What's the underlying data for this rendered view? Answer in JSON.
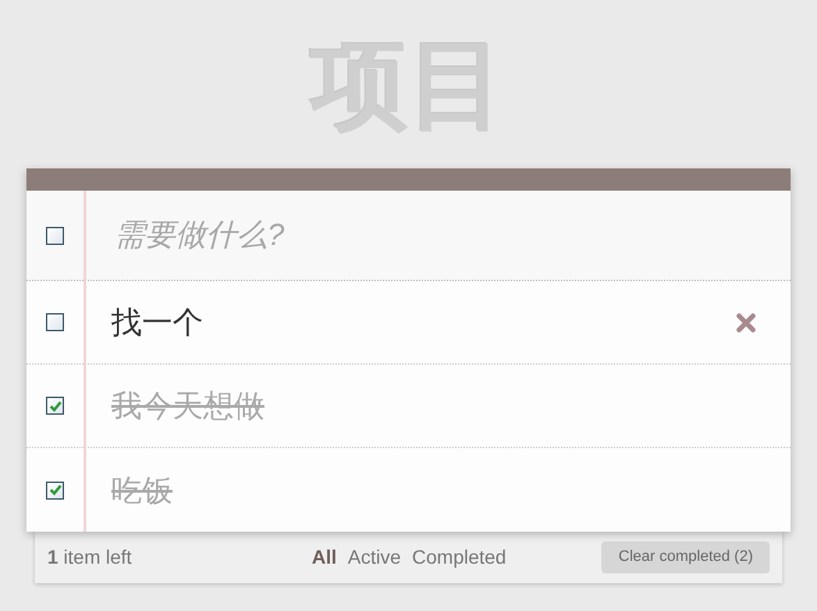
{
  "title": "项目",
  "new_todo": {
    "placeholder": "需要做什么?",
    "toggle_all_checked": false
  },
  "todos": [
    {
      "text": "找一个",
      "completed": false,
      "show_delete": true
    },
    {
      "text": "我今天想做",
      "completed": true,
      "show_delete": false
    },
    {
      "text": "吃饭",
      "completed": true,
      "show_delete": false
    }
  ],
  "footer": {
    "count": "**1** item left",
    "filters": [
      {
        "label": "All",
        "selected": true
      },
      {
        "label": "Active",
        "selected": false
      },
      {
        "label": "Completed",
        "selected": false
      }
    ],
    "clear_button": "Clear completed (2)"
  }
}
